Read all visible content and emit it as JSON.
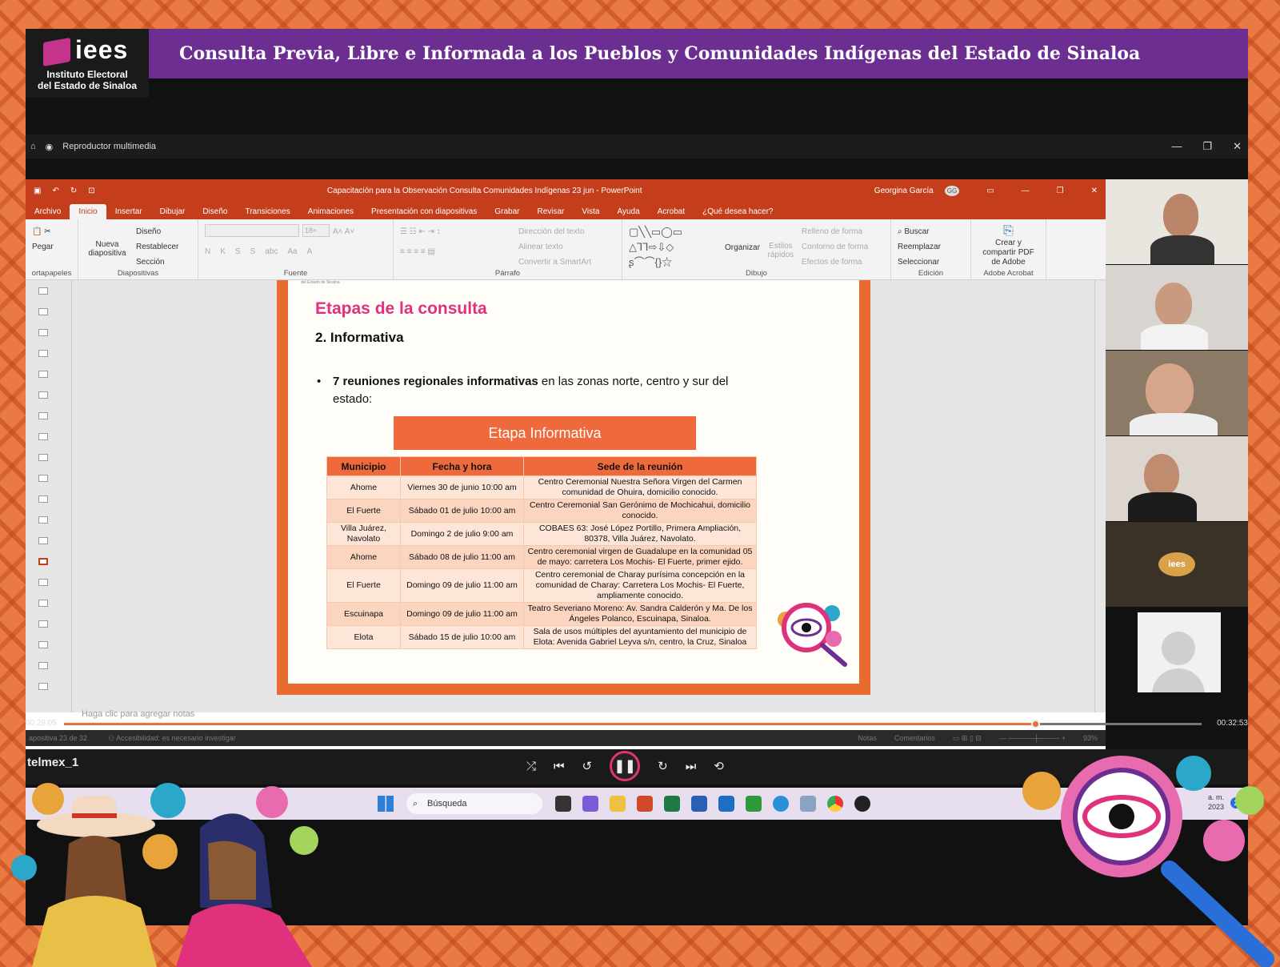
{
  "header": {
    "logo_word": "iees",
    "logo_subtitle_line1": "Instituto Electoral",
    "logo_subtitle_line2": "del Estado de Sinaloa",
    "banner_title": "Consulta Previa, Libre e Informada a los Pueblos y Comunidades Indígenas del Estado de Sinaloa"
  },
  "player": {
    "app_title": "Reproductor multimedia",
    "elapsed": "00:28:05",
    "total": "00:32:53",
    "progress": 0.854,
    "source_label": "telmex_1"
  },
  "powerpoint": {
    "window_title": "Capacitación para la Observación  Consulta Comunidades Indígenas 23 jun  -  PowerPoint",
    "user_name": "Georgina García",
    "user_initials": "GG",
    "tabs": [
      "Archivo",
      "Inicio",
      "Insertar",
      "Dibujar",
      "Diseño",
      "Transiciones",
      "Animaciones",
      "Presentación con diapositivas",
      "Grabar",
      "Revisar",
      "Vista",
      "Ayuda",
      "Acrobat",
      "¿Qué desea hacer?"
    ],
    "active_tab": "Inicio",
    "ribbon": {
      "portapapeles": {
        "label": "ortapapeles",
        "pegar": "Pegar"
      },
      "diapositivas": {
        "label": "Diapositivas",
        "nueva": "Nueva diapositiva",
        "diseno": "Diseño",
        "restablecer": "Restablecer",
        "seccion": "Sección"
      },
      "fuente": {
        "label": "Fuente",
        "size": "18+",
        "bold": "N",
        "italic": "K",
        "underline": "S",
        "strike": "S",
        "abc": "abc",
        "case": "Aa"
      },
      "parrafo": {
        "label": "Párrafo",
        "direccion": "Dirección del texto",
        "alinear": "Alinear texto",
        "smartart": "Convertir a SmartArt"
      },
      "dibujo": {
        "label": "Dibujo",
        "organizar": "Organizar",
        "estilos": "Estilos rápidos",
        "relleno": "Relleno de forma",
        "contorno": "Contorno de forma",
        "efectos": "Efectos de forma"
      },
      "edicion": {
        "label": "Edición",
        "buscar": "Buscar",
        "reemplazar": "Reemplazar",
        "seleccionar": "Seleccionar"
      },
      "acrobat": {
        "label": "Adobe Acrobat",
        "crear": "Crear y compartir PDF de Adobe"
      }
    },
    "notes_placeholder": "Haga clic para agregar notas",
    "status": {
      "slide_counter": "apositiva 23 de 32",
      "accessibility": "Accesibilidad: es necesario investigar",
      "notas": "Notas",
      "comentarios": "Comentarios",
      "zoom": "93%"
    }
  },
  "slide": {
    "header_small": "del Estado de Sinaloa",
    "title": "Etapas de la consulta",
    "subtitle": "2. Informativa",
    "bullet_bold": "7 reuniones regionales informativas",
    "bullet_rest": " en las zonas norte, centro y sur del estado:",
    "banner": "Etapa Informativa",
    "table_headers": [
      "Municipio",
      "Fecha y hora",
      "Sede de la reunión"
    ],
    "rows": [
      [
        "Ahome",
        "Viernes 30 de junio 10:00 am",
        "Centro Ceremonial Nuestra Señora Virgen del Carmen comunidad de Ohuira, domicilio conocido."
      ],
      [
        "El Fuerte",
        "Sábado 01 de julio 10:00 am",
        "Centro Ceremonial San Gerónimo de Mochicahui, domicilio conocido."
      ],
      [
        "Villa Juárez, Navolato",
        "Domingo 2 de julio 9:00 am",
        "COBAES 63: José López Portillo, Primera Ampliación, 80378, Villa Juárez, Navolato."
      ],
      [
        "Ahome",
        "Sábado 08 de julio 11:00 am",
        "Centro ceremonial virgen de Guadalupe en la comunidad 05 de mayo: carretera Los Mochis- El Fuerte, primer ejido."
      ],
      [
        "El Fuerte",
        "Domingo 09 de julio 11:00 am",
        "Centro ceremonial de Charay purísima concepción en la comunidad de Charay: Carretera Los Mochis- El Fuerte, ampliamente conocido."
      ],
      [
        "Escuinapa",
        "Domingo 09 de julio 11:00 am",
        "Teatro Severiano Moreno: Av. Sandra Calderón y Ma. De los Ángeles Polanco, Escuinapa, Sinaloa."
      ],
      [
        "Elota",
        "Sábado 15 de julio 10:00 am",
        "Sala de usos múltiples del ayuntamiento del municipio de Elota: Avenida Gabriel Leyva s/n, centro, la Cruz, Sinaloa"
      ]
    ]
  },
  "taskbar": {
    "search_placeholder": "Búsqueda",
    "tray_time": "a. m.",
    "tray_year": "2023",
    "notification_count": "2"
  },
  "participants": {
    "tile_logo": "iees"
  },
  "colors": {
    "frame_orange": "#e8713a",
    "banner_purple": "#6c2e91",
    "ppt_red": "#c43e1c",
    "slide_pink_title": "#e0317d",
    "table_header": "#ee6a3c"
  }
}
